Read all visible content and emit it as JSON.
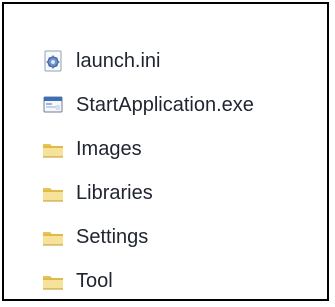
{
  "items": [
    {
      "name": "launch.ini",
      "type": "settings-file",
      "icon": "config-file-icon"
    },
    {
      "name": "StartApplication.exe",
      "type": "executable",
      "icon": "application-icon"
    },
    {
      "name": "Images",
      "type": "folder",
      "icon": "folder-icon"
    },
    {
      "name": "Libraries",
      "type": "folder",
      "icon": "folder-icon"
    },
    {
      "name": "Settings",
      "type": "folder",
      "icon": "folder-icon"
    },
    {
      "name": "Tool",
      "type": "folder",
      "icon": "folder-icon"
    }
  ],
  "colors": {
    "text": "#1f2430",
    "border": "#000000",
    "folder_light": "#f6df8a",
    "folder_mid": "#e5bf44",
    "folder_dark": "#c6952a"
  }
}
